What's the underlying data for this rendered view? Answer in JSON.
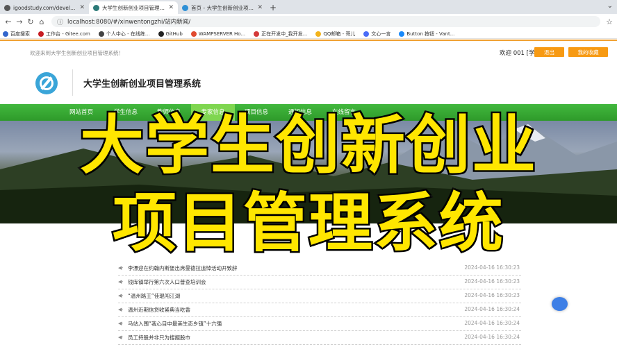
{
  "browser": {
    "tabs": [
      {
        "title": "igoodstudy.com/developer/",
        "active": false,
        "favicon_color": "#555555"
      },
      {
        "title": "大学生创新创业项目管理系统",
        "active": true,
        "favicon_color": "#2b7a78"
      },
      {
        "title": "首页 - 大学生创新创业项目管理系",
        "active": false,
        "favicon_color": "#2c8fd6"
      }
    ],
    "new_tab_label": "+",
    "url": "localhost:8080/#/xinwentongzhi/站内新闻/",
    "bookmarks": [
      {
        "label": "百度搜索",
        "color": "#3366cc"
      },
      {
        "label": "工作台 - Gitee.com",
        "color": "#c71d23"
      },
      {
        "label": "个人中心 - 在线练...",
        "color": "#444444"
      },
      {
        "label": "GitHub",
        "color": "#222222"
      },
      {
        "label": "WAMPSERVER Ho...",
        "color": "#e04a2f"
      },
      {
        "label": "正在开发中_我开发...",
        "color": "#d43a3a"
      },
      {
        "label": "QQ邮箱 - 哥儿",
        "color": "#f3b31b"
      },
      {
        "label": "文心一言",
        "color": "#4a6cf7"
      },
      {
        "label": "Button 按钮 - Vant...",
        "color": "#1989fa"
      }
    ]
  },
  "header": {
    "welcome_text": "欢迎来到大学生创新创业项目管理系统！",
    "user_greeting": "欢迎 001 [学生]",
    "logout_label": "退出",
    "favorites_label": "我的收藏",
    "site_title": "大学生创新创业项目管理系统",
    "accent_color": "#f79a13"
  },
  "nav": {
    "items": [
      "网站首页",
      "学生信息",
      "教师信息",
      "专家信息",
      "项目信息",
      "通知信息",
      "在线留言"
    ],
    "active_index": 3,
    "color": "#3aac36"
  },
  "overlay": {
    "line1": "大学生创新创业",
    "line2": "项目管理系统"
  },
  "news": [
    {
      "title": "李漂迎在约翰内斯堡出席曼德拉追悼活动开致辞",
      "date": "2024-04-16 16:30:23"
    },
    {
      "title": "钱库镇举行第六次人口普查培训会",
      "date": "2024-04-16 16:30:23"
    },
    {
      "title": "“温州路王”佳琨闯江湖",
      "date": "2024-04-16 16:30:23"
    },
    {
      "title": "温州近期信贷收紧典当吃香",
      "date": "2024-04-16 16:30:24"
    },
    {
      "title": "马站入围“我心目中最美生态乡镇”十六强",
      "date": "2024-04-16 16:30:24"
    },
    {
      "title": "员工持股并非只为搜掘股市",
      "date": "2024-04-16 16:30:24"
    }
  ]
}
